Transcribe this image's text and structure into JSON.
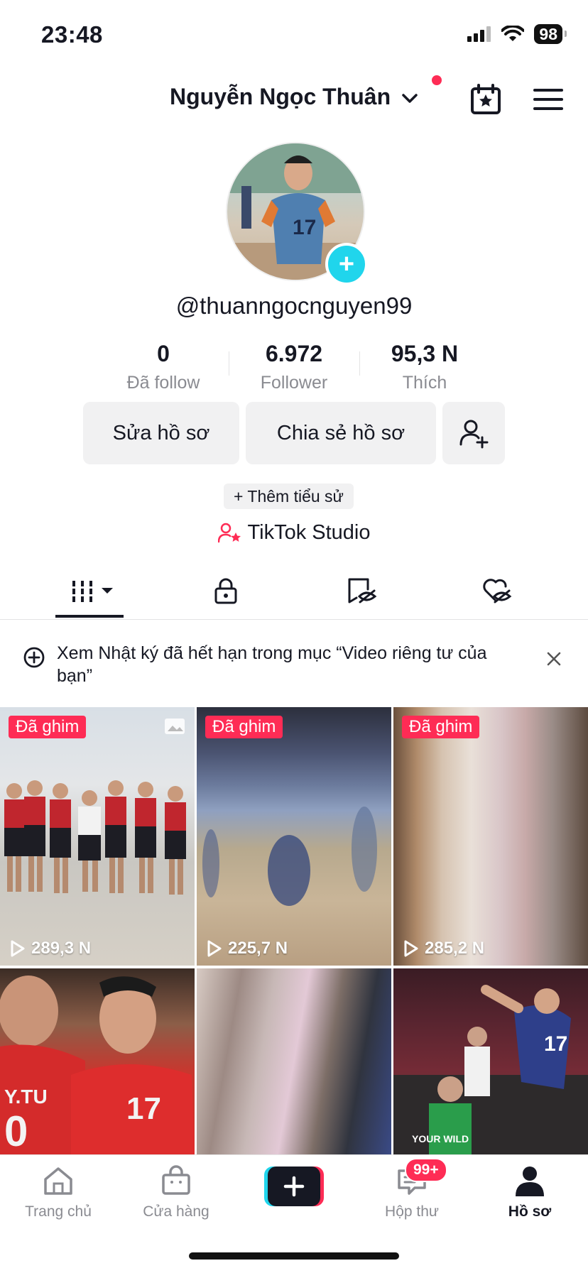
{
  "status_bar": {
    "time": "23:48",
    "battery": "98"
  },
  "header": {
    "username": "Nguyễn Ngọc Thuân"
  },
  "profile": {
    "handle": "@thuanngocnguyen99",
    "stats": [
      {
        "value": "0",
        "label": "Đã follow"
      },
      {
        "value": "6.972",
        "label": "Follower"
      },
      {
        "value": "95,3 N",
        "label": "Thích"
      }
    ],
    "edit_button": "Sửa hồ sơ",
    "share_button": "Chia sẻ hồ sơ",
    "bio_chip": "+ Thêm tiểu sử",
    "studio": "TikTok Studio"
  },
  "notice": {
    "text": "Xem Nhật ký đã hết hạn trong mục “Video riêng tư của bạn”"
  },
  "videos": [
    {
      "pinned": "Đã ghim",
      "views": "289,3 N"
    },
    {
      "pinned": "Đã ghim",
      "views": "225,7 N"
    },
    {
      "pinned": "Đã ghim",
      "views": "285,2 N"
    },
    {
      "pinned": "",
      "views": ""
    },
    {
      "pinned": "",
      "views": ""
    },
    {
      "pinned": "",
      "views": ""
    }
  ],
  "thumbnail_text": {
    "video6": "YOUR WILD"
  },
  "bottom_nav": {
    "home": "Trang chủ",
    "shop": "Cửa hàng",
    "inbox": "Hộp thư",
    "inbox_badge": "99+",
    "profile": "Hồ sơ"
  },
  "colors": {
    "accent": "#fe2c55",
    "cyan": "#20d5ec",
    "text": "#161823",
    "muted": "#8a8b91"
  }
}
